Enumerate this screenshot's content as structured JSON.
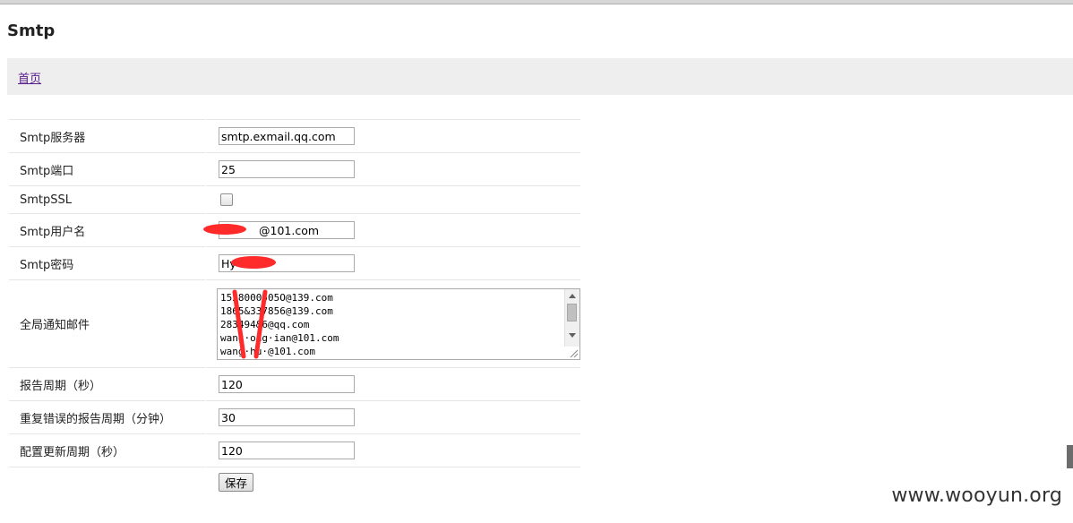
{
  "page": {
    "title": "Smtp"
  },
  "nav": {
    "home_label": "首页"
  },
  "form": {
    "fields": [
      {
        "label": "Smtp服务器",
        "value": "smtp.exmail.qq.com"
      },
      {
        "label": "Smtp端口",
        "value": "25"
      },
      {
        "label": "SmtpSSL",
        "checked": false
      },
      {
        "label": "Smtp用户名",
        "value": "@101.com"
      },
      {
        "label": "Smtp密码",
        "value": "Hy"
      },
      {
        "label": "全局通知邮件",
        "value": "1528000505O@139.com\n1865&337856@139.com\n283494&6@qq.com\nwang·ong·ian@101.com\nwang·hu·@101.com"
      },
      {
        "label": "报告周期（秒）",
        "value": "120"
      },
      {
        "label": "重复错误的报告周期（分钟）",
        "value": "30"
      },
      {
        "label": "配置更新周期（秒）",
        "value": "120"
      }
    ],
    "save_label": "保存"
  },
  "watermark": "www.wooyun.org",
  "colors": {
    "nav_background": "#eeeeee",
    "link": "#551a8b",
    "redaction": "#ff2a2a"
  }
}
